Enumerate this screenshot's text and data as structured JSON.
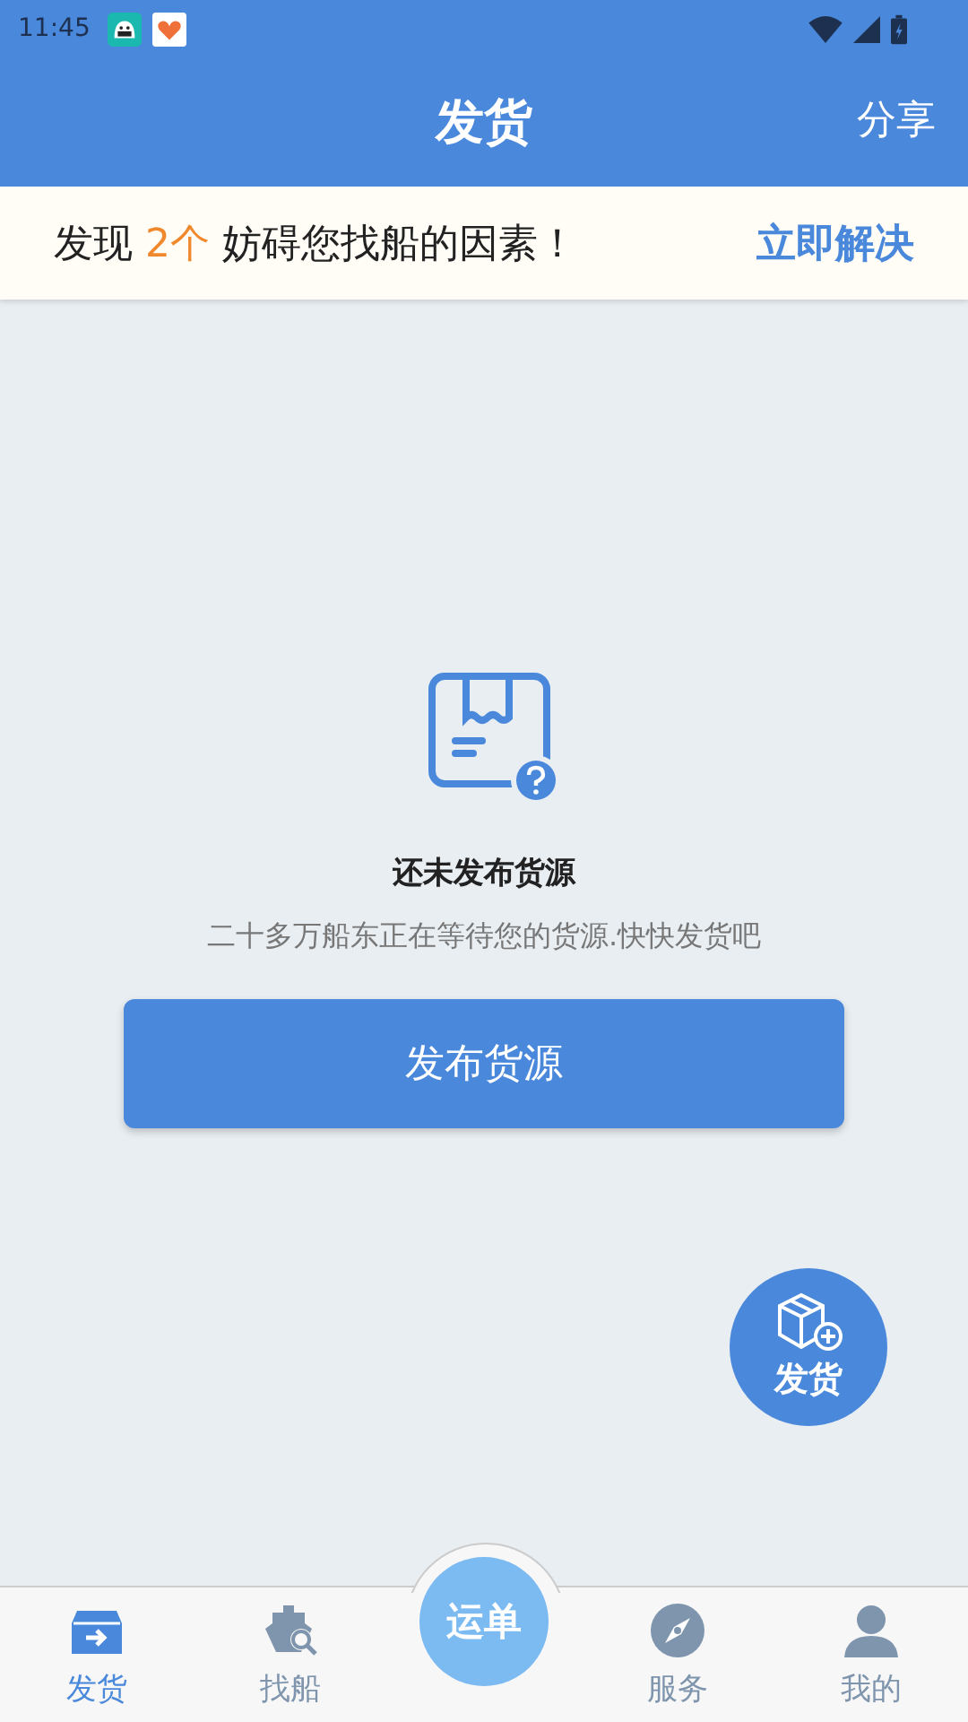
{
  "status_bar": {
    "time": "11:45"
  },
  "header": {
    "title": "发货",
    "action": "分享"
  },
  "banner": {
    "before": "发现",
    "count": "2个",
    "after": "妨碍您找船的因素！",
    "action": "立即解决"
  },
  "empty_state": {
    "title": "还未发布货源",
    "message": "二十多万船东正在等待您的货源.快快发货吧",
    "button": "发布货源"
  },
  "fab": {
    "label": "发货"
  },
  "tab_bar": [
    {
      "kind": "tab",
      "label": "发货",
      "selected": true
    },
    {
      "kind": "tab",
      "label": "找船",
      "selected": false
    },
    {
      "kind": "center",
      "label": "运单",
      "selected": false
    },
    {
      "kind": "tab",
      "label": "服务",
      "selected": false
    },
    {
      "kind": "tab",
      "label": "我的",
      "selected": false
    }
  ]
}
